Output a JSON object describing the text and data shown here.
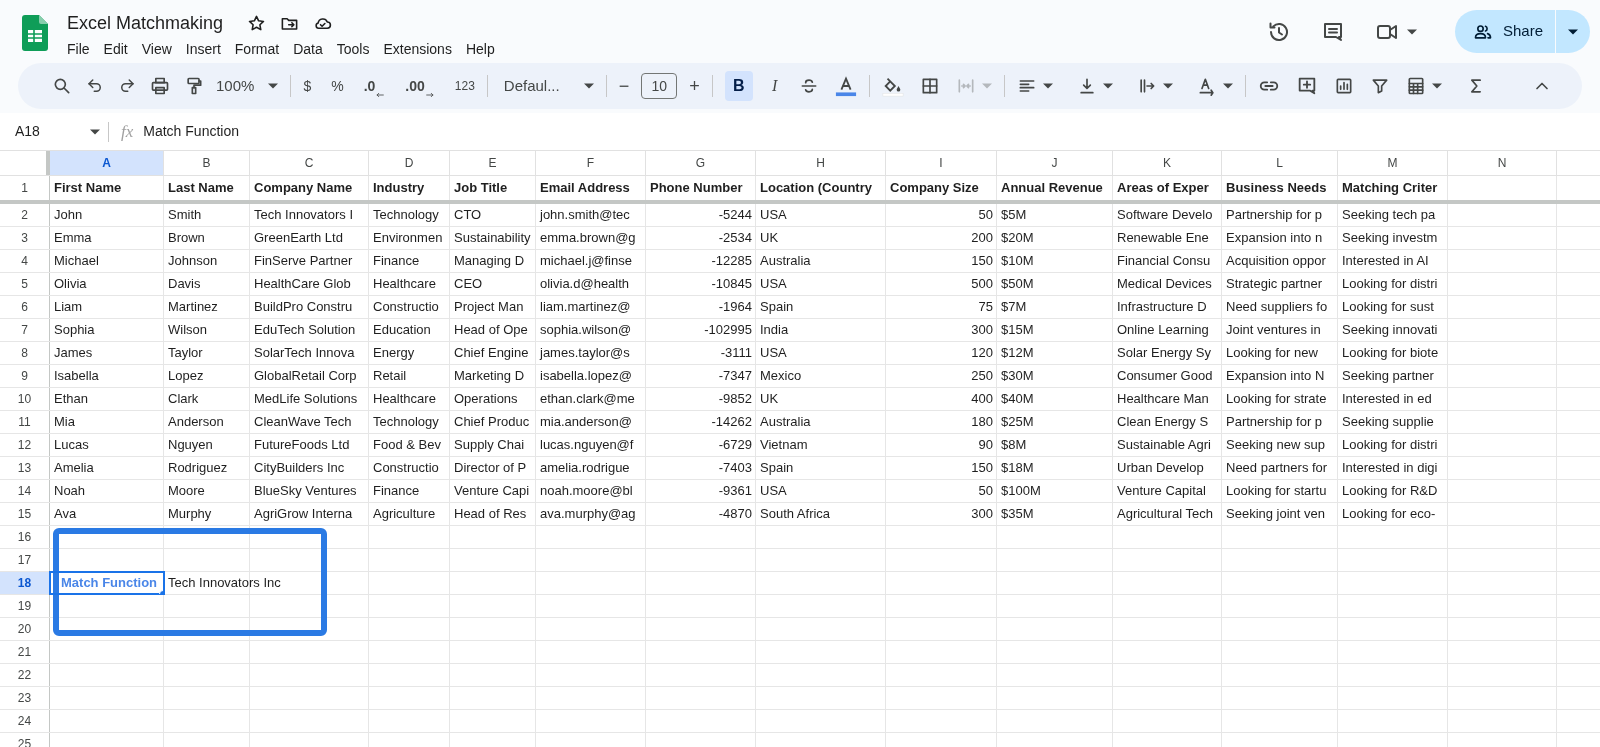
{
  "document": {
    "title": "Excel Matchmaking"
  },
  "menu": [
    {
      "label": "File"
    },
    {
      "label": "Edit"
    },
    {
      "label": "View"
    },
    {
      "label": "Insert"
    },
    {
      "label": "Format"
    },
    {
      "label": "Data"
    },
    {
      "label": "Tools"
    },
    {
      "label": "Extensions"
    },
    {
      "label": "Help"
    }
  ],
  "share_button": {
    "label": "Share"
  },
  "toolbar": {
    "zoom": "100%",
    "currency": "$",
    "percent": "%",
    "decrease_decimals": ".0",
    "increase_decimals": ".00",
    "number_format": "123",
    "font": "Defaul...",
    "font_size": "10",
    "minus": "−",
    "plus": "+",
    "format_buttons": [
      {
        "label": "B",
        "selected": true
      },
      {
        "label": "I",
        "selected": false
      }
    ]
  },
  "formula_bar": {
    "name_box": "A18",
    "fx": "fx",
    "value": "Match Function"
  },
  "columns": [
    {
      "letter": "A",
      "selected": true,
      "kind": "text"
    },
    {
      "letter": "B",
      "selected": false,
      "kind": "text"
    },
    {
      "letter": "C",
      "selected": false,
      "kind": "text"
    },
    {
      "letter": "D",
      "selected": false,
      "kind": "text"
    },
    {
      "letter": "E",
      "selected": false,
      "kind": "text"
    },
    {
      "letter": "F",
      "selected": false,
      "kind": "text"
    },
    {
      "letter": "G",
      "selected": false,
      "kind": "number"
    },
    {
      "letter": "H",
      "selected": false,
      "kind": "text"
    },
    {
      "letter": "I",
      "selected": false,
      "kind": "number"
    },
    {
      "letter": "J",
      "selected": false,
      "kind": "text"
    },
    {
      "letter": "K",
      "selected": false,
      "kind": "text"
    },
    {
      "letter": "L",
      "selected": false,
      "kind": "text"
    },
    {
      "letter": "M",
      "selected": false,
      "kind": "text"
    },
    {
      "letter": "N",
      "selected": false
    }
  ],
  "rows": [
    {
      "number": "1",
      "selected": false,
      "kind": "header",
      "cells": [
        "First Name",
        "Last Name",
        "Company Name",
        "Industry",
        "Job Title",
        "Email Address",
        "Phone Number",
        "Location (Country",
        "Company Size",
        "Annual Revenue",
        "Areas of Exper",
        "Business Needs",
        "Matching Criter"
      ]
    },
    {
      "number": "2",
      "selected": false,
      "kind": "data",
      "cells": [
        "John",
        "Smith",
        "Tech Innovators I",
        "Technology",
        "CTO",
        "john.smith@tec",
        "-5244",
        "USA",
        "50",
        "$5M",
        "Software Develo",
        "Partnership for p",
        "Seeking tech pa"
      ]
    },
    {
      "number": "3",
      "selected": false,
      "kind": "data",
      "cells": [
        "Emma",
        "Brown",
        "GreenEarth Ltd",
        "Environmen",
        "Sustainability",
        "emma.brown@g",
        "-2534",
        "UK",
        "200",
        "$20M",
        "Renewable Ene",
        "Expansion into n",
        "Seeking investm"
      ]
    },
    {
      "number": "4",
      "selected": false,
      "kind": "data",
      "cells": [
        "Michael",
        "Johnson",
        "FinServe Partner",
        "Finance",
        "Managing D",
        "michael.j@finse",
        "-12285",
        "Australia",
        "150",
        "$10M",
        "Financial Consu",
        "Acquisition oppor",
        "Interested in AI"
      ]
    },
    {
      "number": "5",
      "selected": false,
      "kind": "data",
      "cells": [
        "Olivia",
        "Davis",
        "HealthCare Glob",
        "Healthcare",
        "CEO",
        "olivia.d@health",
        "-10845",
        "USA",
        "500",
        "$50M",
        "Medical Devices",
        "Strategic partner",
        "Looking for distri"
      ]
    },
    {
      "number": "6",
      "selected": false,
      "kind": "data",
      "cells": [
        "Liam",
        "Martinez",
        "BuildPro Constru",
        "Constructio",
        "Project Man",
        "liam.martinez@",
        "-1964",
        "Spain",
        "75",
        "$7M",
        "Infrastructure D",
        "Need suppliers fo",
        "Looking for sust"
      ]
    },
    {
      "number": "7",
      "selected": false,
      "kind": "data",
      "cells": [
        "Sophia",
        "Wilson",
        "EduTech Solution",
        "Education",
        "Head of Ope",
        "sophia.wilson@",
        "-102995",
        "India",
        "300",
        "$15M",
        "Online Learning",
        "Joint ventures in",
        "Seeking innovati"
      ]
    },
    {
      "number": "8",
      "selected": false,
      "kind": "data",
      "cells": [
        "James",
        "Taylor",
        "SolarTech Innova",
        "Energy",
        "Chief Engine",
        "james.taylor@s",
        "-3111",
        "USA",
        "120",
        "$12M",
        "Solar Energy Sy",
        "Looking for new",
        "Looking for biote"
      ]
    },
    {
      "number": "9",
      "selected": false,
      "kind": "data",
      "cells": [
        "Isabella",
        "Lopez",
        "GlobalRetail Corp",
        "Retail",
        "Marketing D",
        "isabella.lopez@",
        "-7347",
        "Mexico",
        "250",
        "$30M",
        "Consumer Good",
        "Expansion into N",
        "Seeking partner"
      ]
    },
    {
      "number": "10",
      "selected": false,
      "kind": "data",
      "cells": [
        "Ethan",
        "Clark",
        "MedLife Solutions",
        "Healthcare",
        "Operations",
        "ethan.clark@me",
        "-9852",
        "UK",
        "400",
        "$40M",
        "Healthcare Man",
        "Looking for strate",
        "Interested in ed"
      ]
    },
    {
      "number": "11",
      "selected": false,
      "kind": "data",
      "cells": [
        "Mia",
        "Anderson",
        "CleanWave Tech",
        "Technology",
        "Chief Produc",
        "mia.anderson@",
        "-14262",
        "Australia",
        "180",
        "$25M",
        "Clean Energy S",
        "Partnership for p",
        "Seeking supplie"
      ]
    },
    {
      "number": "12",
      "selected": false,
      "kind": "data",
      "cells": [
        "Lucas",
        "Nguyen",
        "FutureFoods Ltd",
        "Food & Bev",
        "Supply Chai",
        "lucas.nguyen@f",
        "-6729",
        "Vietnam",
        "90",
        "$8M",
        "Sustainable Agri",
        "Seeking new sup",
        "Looking for distri"
      ]
    },
    {
      "number": "13",
      "selected": false,
      "kind": "data",
      "cells": [
        "Amelia",
        "Rodriguez",
        "CityBuilders Inc",
        "Constructio",
        "Director of P",
        "amelia.rodrigue",
        "-7403",
        "Spain",
        "150",
        "$18M",
        "Urban Develop",
        "Need partners for",
        "Interested in digi"
      ]
    },
    {
      "number": "14",
      "selected": false,
      "kind": "data",
      "cells": [
        "Noah",
        "Moore",
        "BlueSky Ventures",
        "Finance",
        "Venture Capi",
        "noah.moore@bl",
        "-9361",
        "USA",
        "50",
        "$100M",
        "Venture Capital",
        "Looking for startu",
        "Looking for R&D"
      ]
    },
    {
      "number": "15",
      "selected": false,
      "kind": "data",
      "cells": [
        "Ava",
        "Murphy",
        "AgriGrow Interna",
        "Agriculture",
        "Head of Res",
        "ava.murphy@ag",
        "-4870",
        "South Africa",
        "300",
        "$35M",
        "Agricultural Tech",
        "Seeking joint ven",
        "Looking for eco-"
      ]
    },
    {
      "number": "16",
      "selected": false,
      "kind": "data",
      "cells": []
    },
    {
      "number": "17",
      "selected": false,
      "kind": "data",
      "cells": []
    },
    {
      "number": "18",
      "selected": true,
      "kind": "data",
      "cells": [
        {
          "text": "Match Function",
          "active": true
        },
        "Tech Innovators Inc"
      ]
    },
    {
      "number": "19",
      "selected": false,
      "kind": "data",
      "cells": []
    },
    {
      "number": "20",
      "selected": false,
      "kind": "data",
      "cells": []
    },
    {
      "number": "21",
      "selected": false,
      "kind": "data",
      "cells": []
    },
    {
      "number": "22",
      "selected": false,
      "kind": "data",
      "cells": []
    },
    {
      "number": "23",
      "selected": false,
      "kind": "data",
      "cells": []
    },
    {
      "number": "24",
      "selected": false,
      "kind": "data",
      "cells": []
    },
    {
      "number": "25",
      "selected": false,
      "kind": "data",
      "cells": []
    }
  ]
}
